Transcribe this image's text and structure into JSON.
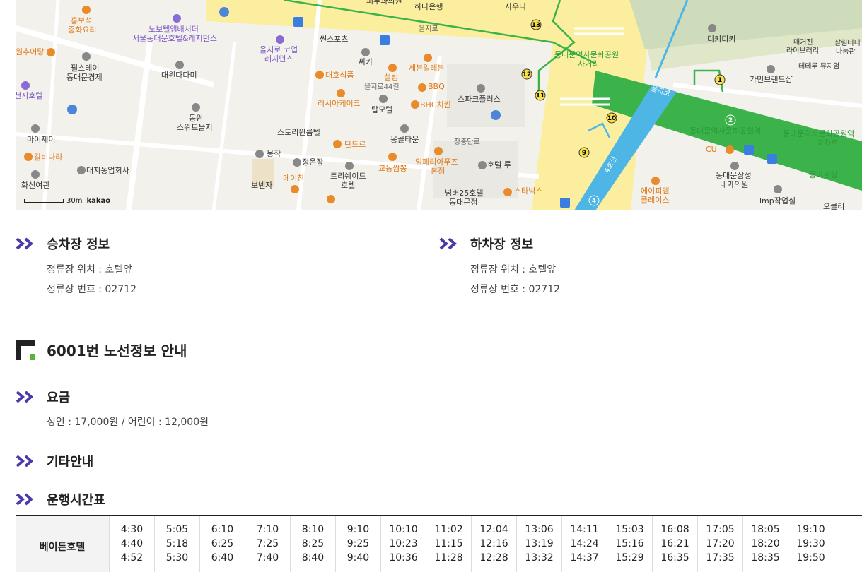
{
  "map": {
    "labels": [
      {
        "t": "홍보석",
        "c": "o"
      },
      {
        "t": "중화요리",
        "c": "o"
      },
      {
        "t": "노보텔앰배서더",
        "c": "p"
      },
      {
        "t": "서울동대문호텔&레지던스",
        "c": "p"
      },
      {
        "t": "피부과의원",
        "c": ""
      },
      {
        "t": "하나은행",
        "c": ""
      },
      {
        "t": "사우나",
        "c": ""
      },
      {
        "t": "을지로",
        "c": ""
      },
      {
        "t": "을지로 코업",
        "c": "p"
      },
      {
        "t": "레지던스",
        "c": "p"
      },
      {
        "t": "썬스포츠",
        "c": ""
      },
      {
        "t": "원추어탕",
        "c": "o"
      },
      {
        "t": "필스테이",
        "c": ""
      },
      {
        "t": "동대문경제",
        "c": ""
      },
      {
        "t": "대원다다미",
        "c": ""
      },
      {
        "t": "싸카",
        "c": ""
      },
      {
        "t": "대호식품",
        "c": "o"
      },
      {
        "t": "설빙",
        "c": "o"
      },
      {
        "t": "세븐일레븐",
        "c": "o"
      },
      {
        "t": "동대문역사문화공원",
        "c": "g"
      },
      {
        "t": "사거리",
        "c": "g"
      },
      {
        "t": "디키디키",
        "c": ""
      },
      {
        "t": "매거진",
        "c": ""
      },
      {
        "t": "라이브러리",
        "c": ""
      },
      {
        "t": "살림터디",
        "c": ""
      },
      {
        "t": "나눔관",
        "c": ""
      },
      {
        "t": "테테루 뮤지엄",
        "c": ""
      },
      {
        "t": "가민브랜드샵",
        "c": ""
      },
      {
        "t": "천지호텔",
        "c": "p"
      },
      {
        "t": "을지로44길",
        "c": ""
      },
      {
        "t": "BBQ",
        "c": "o"
      },
      {
        "t": "스파크플러스",
        "c": ""
      },
      {
        "t": "러시아케이크",
        "c": "o"
      },
      {
        "t": "탑모텔",
        "c": ""
      },
      {
        "t": "BHC치킨",
        "c": "o"
      },
      {
        "t": "동원",
        "c": ""
      },
      {
        "t": "스위트을지",
        "c": ""
      },
      {
        "t": "마이제이",
        "c": ""
      },
      {
        "t": "스토리원룸텔",
        "c": ""
      },
      {
        "t": "몽골타운",
        "c": ""
      },
      {
        "t": "동대문역사문화공원역",
        "c": "g"
      },
      {
        "t": "동대문역사문화공원역",
        "c": "g"
      },
      {
        "t": "교차로",
        "c": "g"
      },
      {
        "t": "갈비나라",
        "c": "o"
      },
      {
        "t": "탄드르",
        "c": "o"
      },
      {
        "t": "장충단로",
        "c": ""
      },
      {
        "t": "몽작",
        "c": ""
      },
      {
        "t": "정온장",
        "c": ""
      },
      {
        "t": "임페리아푸즈",
        "c": "o"
      },
      {
        "t": "본점",
        "c": "o"
      },
      {
        "t": "교동짬뽕",
        "c": "o"
      },
      {
        "t": "호텔 루",
        "c": ""
      },
      {
        "t": "CU",
        "c": "o"
      },
      {
        "t": "동아볼링",
        "c": "g"
      },
      {
        "t": "대지농업회사",
        "c": ""
      },
      {
        "t": "트리쉐이드",
        "c": ""
      },
      {
        "t": "호텔",
        "c": ""
      },
      {
        "t": "메이찬",
        "c": "o"
      },
      {
        "t": "보넨자",
        "c": ""
      },
      {
        "t": "4호선",
        "c": ""
      },
      {
        "t": "동대문삼성",
        "c": ""
      },
      {
        "t": "내과의원",
        "c": ""
      },
      {
        "t": "화신여관",
        "c": ""
      },
      {
        "t": "넘버25호텔",
        "c": ""
      },
      {
        "t": "동대문점",
        "c": ""
      },
      {
        "t": "스타벅스",
        "c": "o"
      },
      {
        "t": "에이피엠",
        "c": "o"
      },
      {
        "t": "플레이스",
        "c": "o"
      },
      {
        "t": "lmp작업실",
        "c": ""
      },
      {
        "t": "오클리",
        "c": ""
      },
      {
        "t": "을지로",
        "c": ""
      }
    ],
    "scale": "30m",
    "logo": "kakao"
  },
  "boarding": {
    "title": "승차장 정보",
    "location": "정류장 위치 : 호텔앞",
    "number": "정류장 번호 : 02712"
  },
  "alighting": {
    "title": "하차장 정보",
    "location": "정류장 위치 : 호텔앞",
    "number": "정류장 번호 : 02712"
  },
  "route": {
    "title": "6001번 노선정보 안내"
  },
  "fare": {
    "title": "요금",
    "text": "성인 : 17,000원 / 어린이 : 12,000원"
  },
  "other": {
    "title": "기타안내"
  },
  "timetable": {
    "title": "운행시간표",
    "stop": "베이튼호텔",
    "columns": [
      [
        "4:30",
        "4:40",
        "4:52"
      ],
      [
        "5:05",
        "5:18",
        "5:30"
      ],
      [
        "6:10",
        "6:25",
        "6:40"
      ],
      [
        "7:10",
        "7:25",
        "7:40"
      ],
      [
        "8:10",
        "8:25",
        "8:40"
      ],
      [
        "9:10",
        "9:25",
        "9:40"
      ],
      [
        "10:10",
        "10:23",
        "10:36"
      ],
      [
        "11:02",
        "11:15",
        "11:28"
      ],
      [
        "12:04",
        "12:16",
        "12:28"
      ],
      [
        "13:06",
        "13:19",
        "13:32"
      ],
      [
        "14:11",
        "14:24",
        "14:37"
      ],
      [
        "15:03",
        "15:16",
        "15:29"
      ],
      [
        "16:08",
        "16:21",
        "16:35"
      ],
      [
        "17:05",
        "17:20",
        "17:35"
      ],
      [
        "18:05",
        "18:20",
        "18:35"
      ],
      [
        "19:10",
        "19:30",
        "19:50"
      ]
    ]
  },
  "colors": {
    "accent": "#4b3aa8",
    "route_green": "#3cb34a",
    "line4": "#4db6e5"
  }
}
